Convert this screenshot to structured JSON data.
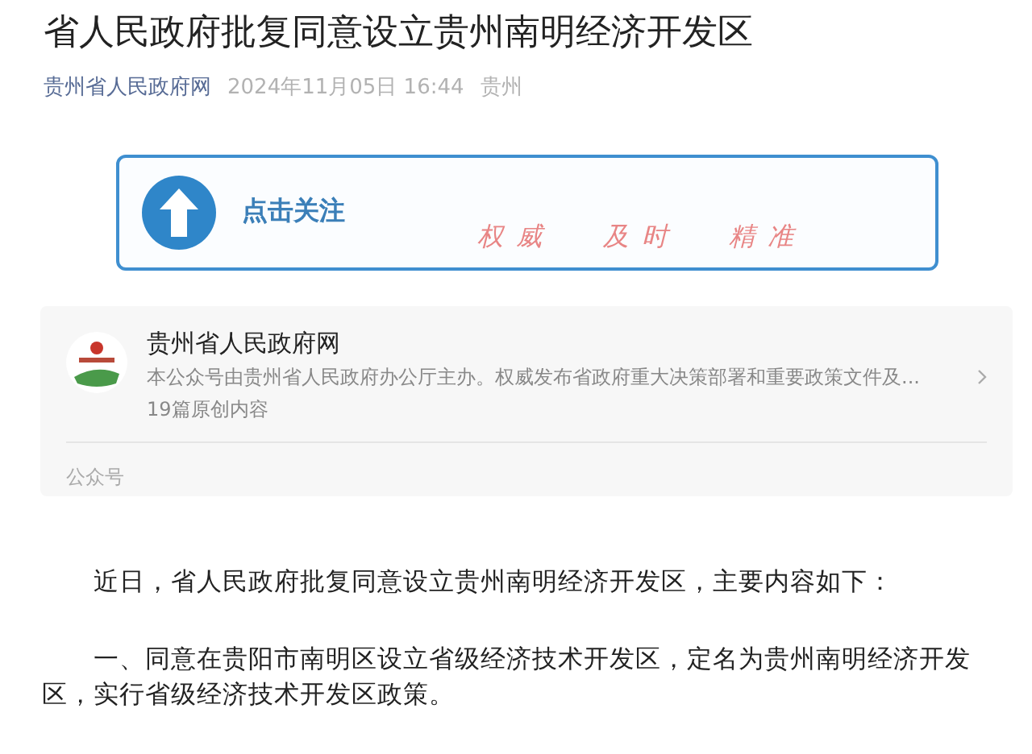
{
  "article": {
    "title": "省人民政府批复同意设立贵州南明经济开发区",
    "source": "贵州省人民政府网",
    "date": "2024年11月05日 16:44",
    "location": "贵州"
  },
  "follow_banner": {
    "label": "点击关注",
    "slogan": [
      "权威",
      "及时",
      "精准"
    ]
  },
  "account_card": {
    "name": "贵州省人民政府网",
    "description": "本公众号由贵州省人民政府办公厅主办。权威发布省政府重大决策部署和重要政策文件及...",
    "count": "19篇原创内容",
    "footer": "公众号"
  },
  "paragraphs": [
    "近日，省人民政府批复同意设立贵州南明经济开发区，主要内容如下：",
    "一、同意在贵阳市南明区设立省级经济技术开发区，定名为贵州南明经济开发区，实行省级经济技术开发区政策。"
  ]
}
